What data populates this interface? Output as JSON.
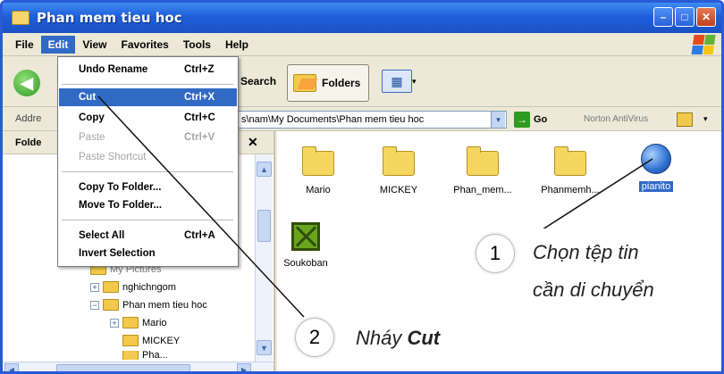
{
  "window": {
    "title": "Phan mem tieu hoc",
    "controls": [
      "–",
      "□",
      "✕"
    ]
  },
  "menubar": {
    "items": [
      "File",
      "Edit",
      "View",
      "Favorites",
      "Tools",
      "Help"
    ],
    "active": "Edit"
  },
  "toolbar": {
    "back_glyph": "◀",
    "search_label": "Search",
    "folders_label": "Folders",
    "views_glyph": "▦"
  },
  "addressbar": {
    "label": "Addre",
    "value": "s\\nam\\My Documents\\Phan mem tieu hoc",
    "go_label": "Go",
    "norton_label": "Norton AntiVirus"
  },
  "folders_pane": {
    "title": "Folde",
    "close_glyph": "✕",
    "tree": [
      {
        "label": "My Pictures",
        "expander": "+"
      },
      {
        "label": "nghichngom",
        "expander": "+"
      },
      {
        "label": "Phan mem tieu hoc",
        "expander": "−"
      },
      {
        "label": "Mario",
        "expander": "+"
      },
      {
        "label": "MICKEY",
        "expander": ""
      },
      {
        "label": "Pha...",
        "expander": ""
      }
    ]
  },
  "files": [
    {
      "name": "Mario",
      "type": "folder",
      "selected": false
    },
    {
      "name": "MICKEY",
      "type": "folder",
      "selected": false
    },
    {
      "name": "Phan_mem...",
      "type": "folder",
      "selected": false
    },
    {
      "name": "Phanmemh...",
      "type": "folder",
      "selected": false
    },
    {
      "name": "pianito",
      "type": "globe",
      "selected": true
    },
    {
      "name": "Soukoban",
      "type": "sokoban",
      "selected": false
    }
  ],
  "edit_menu": {
    "items": [
      {
        "label": "Undo Rename",
        "shortcut": "Ctrl+Z",
        "disabled": false,
        "highlight": false
      },
      {
        "label": "Cut",
        "shortcut": "Ctrl+X",
        "disabled": false,
        "highlight": true
      },
      {
        "label": "Copy",
        "shortcut": "Ctrl+C",
        "disabled": false,
        "highlight": false
      },
      {
        "label": "Paste",
        "shortcut": "Ctrl+V",
        "disabled": true,
        "highlight": false
      },
      {
        "label": "Paste Shortcut",
        "shortcut": "",
        "disabled": true,
        "highlight": false
      },
      {
        "label": "Copy To Folder...",
        "shortcut": "",
        "disabled": false,
        "highlight": false
      },
      {
        "label": "Move To Folder...",
        "shortcut": "",
        "disabled": false,
        "highlight": false
      },
      {
        "label": "Select All",
        "shortcut": "Ctrl+A",
        "disabled": false,
        "highlight": false
      },
      {
        "label": "Invert Selection",
        "shortcut": "",
        "disabled": false,
        "highlight": false
      }
    ]
  },
  "annotations": {
    "step1": {
      "number": "1",
      "line1": "Chọn tệp tin",
      "line2": "cần di chuyển"
    },
    "step2": {
      "number": "2",
      "text_prefix": "Nháy ",
      "text_bold": "Cut"
    }
  },
  "colors": {
    "title_bar": "#1f5fd9",
    "selection": "#316ac5",
    "folder": "#f5d660"
  }
}
